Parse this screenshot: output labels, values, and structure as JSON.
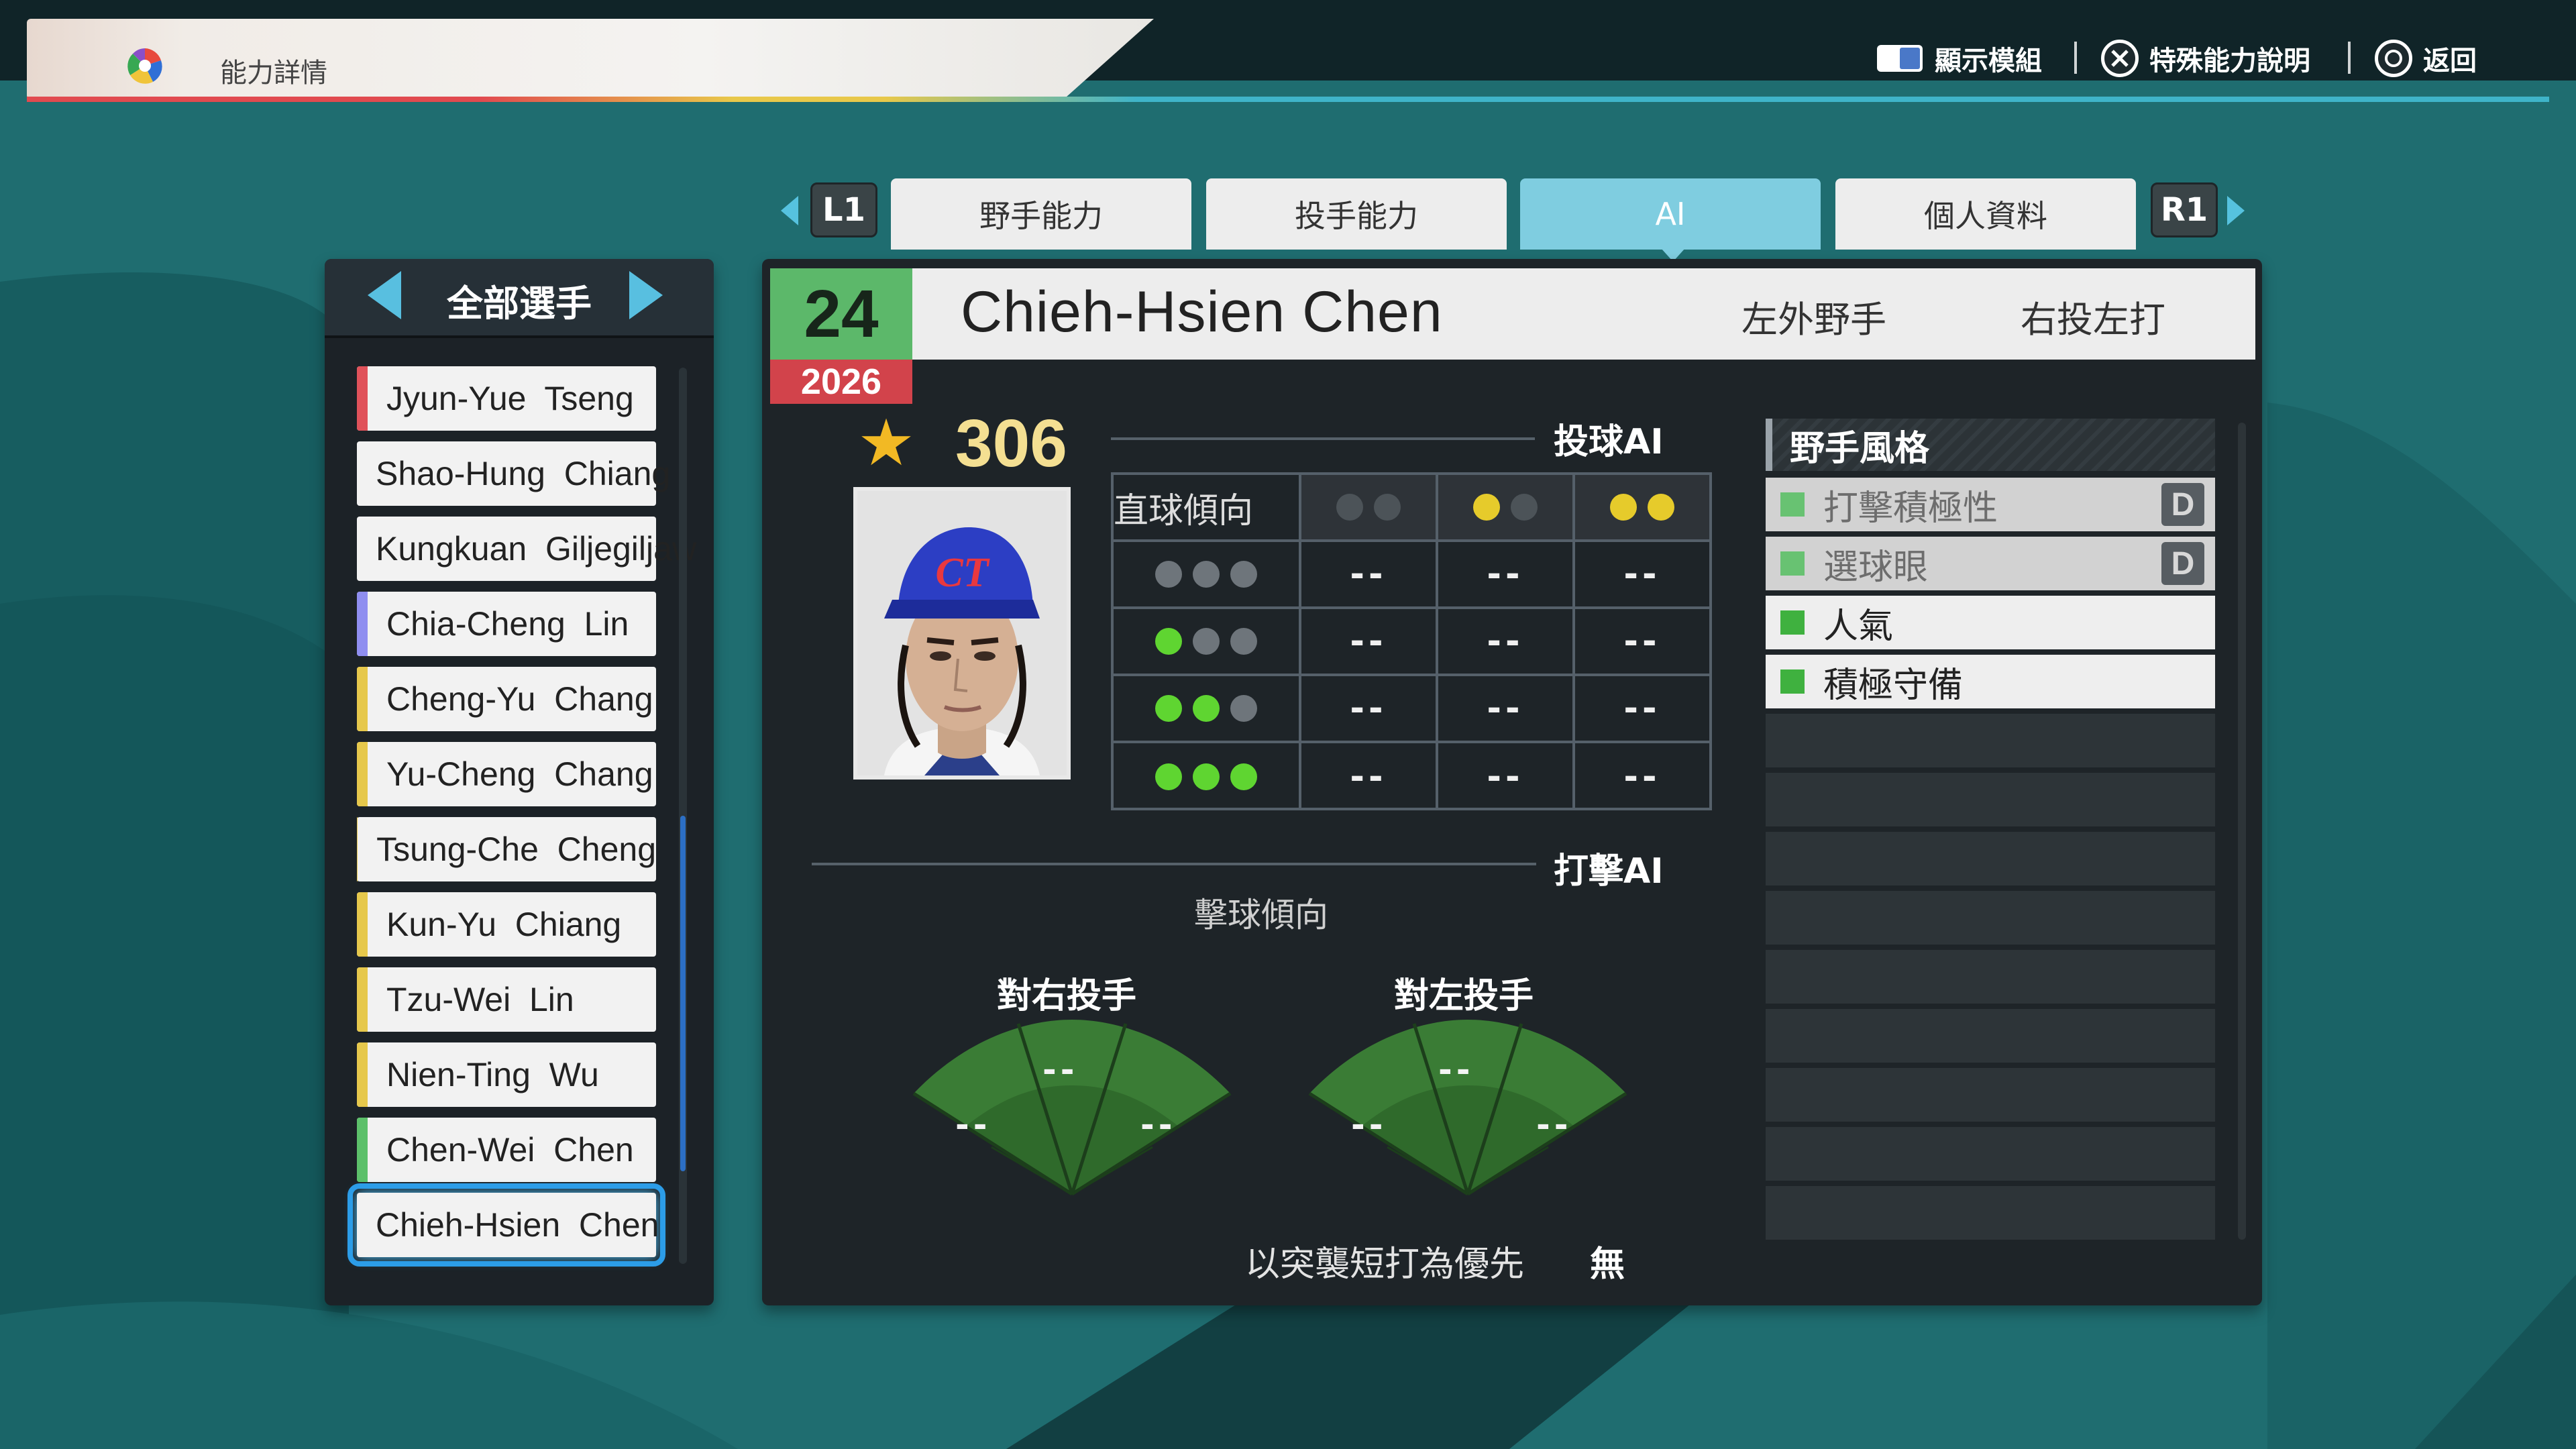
{
  "header": {
    "title": "能力詳情",
    "help_display_model": "顯示模組",
    "help_special_ability": "特殊能力說明",
    "help_back": "返回"
  },
  "tabs": {
    "left_button": "L1",
    "right_button": "R1",
    "items": [
      {
        "label": "野手能力",
        "active": false
      },
      {
        "label": "投手能力",
        "active": false
      },
      {
        "label": "AI",
        "active": true
      },
      {
        "label": "個人資料",
        "active": false
      }
    ]
  },
  "roster": {
    "filter_label": "全部選手",
    "players": [
      {
        "name": "Jyun-Yue  Tseng",
        "color": "#e0525a"
      },
      {
        "name": "Shao-Hung  Chiang",
        "color": "#8f8ef0"
      },
      {
        "name": "Kungkuan  Giljegiljaw",
        "color": "#8f8ef0"
      },
      {
        "name": "Chia-Cheng  Lin",
        "color": "#8f8ef0"
      },
      {
        "name": "Cheng-Yu  Chang",
        "color": "#e6c84c"
      },
      {
        "name": "Yu-Cheng  Chang",
        "color": "#e6c84c"
      },
      {
        "name": "Tsung-Che  Cheng",
        "color": "#e6c84c"
      },
      {
        "name": "Kun-Yu  Chiang",
        "color": "#e6c84c"
      },
      {
        "name": "Tzu-Wei  Lin",
        "color": "#e6c84c"
      },
      {
        "name": "Nien-Ting  Wu",
        "color": "#e6c84c"
      },
      {
        "name": "Chen-Wei  Chen",
        "color": "#5cc06a"
      },
      {
        "name": "Chieh-Hsien  Chen",
        "color": "#5cc06a",
        "selected": true
      }
    ]
  },
  "player": {
    "number": "24",
    "year": "2026",
    "name": "Chieh-Hsien  Chen",
    "position": "左外野手",
    "handedness": "右投左打",
    "overall": "306",
    "cap_logo": "CT"
  },
  "pitch_ai": {
    "section_label": "投球AI",
    "row_header": "直球傾向",
    "columns": [
      "gray-gray",
      "yellow-gray",
      "yellow-yellow"
    ],
    "rows": [
      {
        "dots": [
          "gray",
          "gray",
          "gray"
        ],
        "values": [
          "--",
          "--",
          "--"
        ]
      },
      {
        "dots": [
          "green",
          "gray",
          "gray"
        ],
        "values": [
          "--",
          "--",
          "--"
        ]
      },
      {
        "dots": [
          "green",
          "green",
          "gray"
        ],
        "values": [
          "--",
          "--",
          "--"
        ]
      },
      {
        "dots": [
          "green",
          "green",
          "green"
        ],
        "values": [
          "--",
          "--",
          "--"
        ]
      }
    ]
  },
  "bat_ai": {
    "section_label": "打擊AI",
    "sub_label": "擊球傾向",
    "vs_right": {
      "label": "對右投手",
      "center": "--",
      "left": "--",
      "right": "--"
    },
    "vs_left": {
      "label": "對左投手",
      "center": "--",
      "left": "--",
      "right": "--"
    },
    "bunt_label": "以突襲短打為優先",
    "bunt_value": "無"
  },
  "fielder_style": {
    "header": "野手風格",
    "items": [
      {
        "label": "打擊積極性",
        "grade": "D",
        "dim": true
      },
      {
        "label": "選球眼",
        "grade": "D",
        "dim": true
      },
      {
        "label": "人氣",
        "grade": "",
        "dim": false
      },
      {
        "label": "積極守備",
        "grade": "",
        "dim": false
      }
    ],
    "empty_slots": 9
  },
  "colors": {
    "accent_blue": "#7fcde0",
    "number_green": "#5cb86a",
    "year_red": "#d2434b",
    "ovr_gold": "#f4df92"
  }
}
